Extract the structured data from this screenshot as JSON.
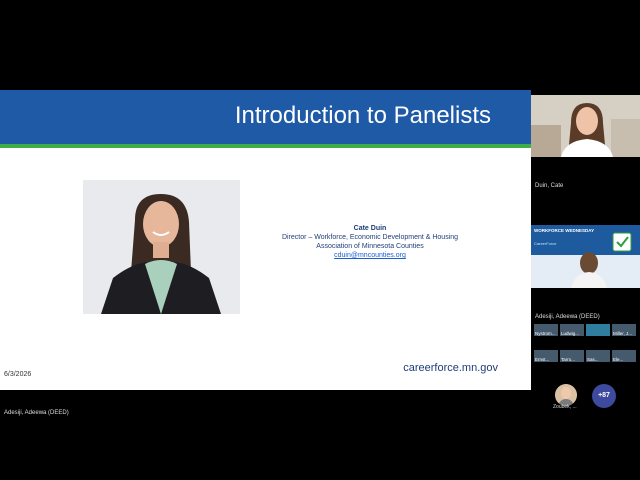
{
  "slide": {
    "title": "Introduction to Panelists",
    "panelist": {
      "name": "Cate Duin",
      "role": "Director – Workforce, Economic Development & Housing",
      "organization": "Association of Minnesota Counties",
      "email": "cduin@mncounties.org"
    },
    "date": "6/3/2026",
    "website": "careerforce.mn.gov"
  },
  "presenter_label": "Adesiji, Adeewa (DEED)",
  "sidebar": {
    "tile1_label": "Duin, Cate",
    "tile2": {
      "label": "Adesiji, Adeewa (DEED)",
      "banner_text": "WORKFORCE WEDNESDAY",
      "banner_sub": "CareerForce"
    },
    "grid": [
      {
        "label": "Nystrom..."
      },
      {
        "label": "Ludwig..."
      },
      {
        "label": ""
      },
      {
        "label": "Miller, J..."
      },
      {
        "label": "Ernst..."
      },
      {
        "label": "Tarro..."
      },
      {
        "label": "Sas..."
      },
      {
        "label": "Ele..."
      }
    ],
    "small_avatar_label": "Zoubek, ...",
    "more_count": "+87"
  },
  "colors": {
    "header_blue": "#1f5aa6",
    "rule_green": "#3fae49",
    "link_blue": "#1a5fd0",
    "more_button": "#3d4a9e"
  }
}
